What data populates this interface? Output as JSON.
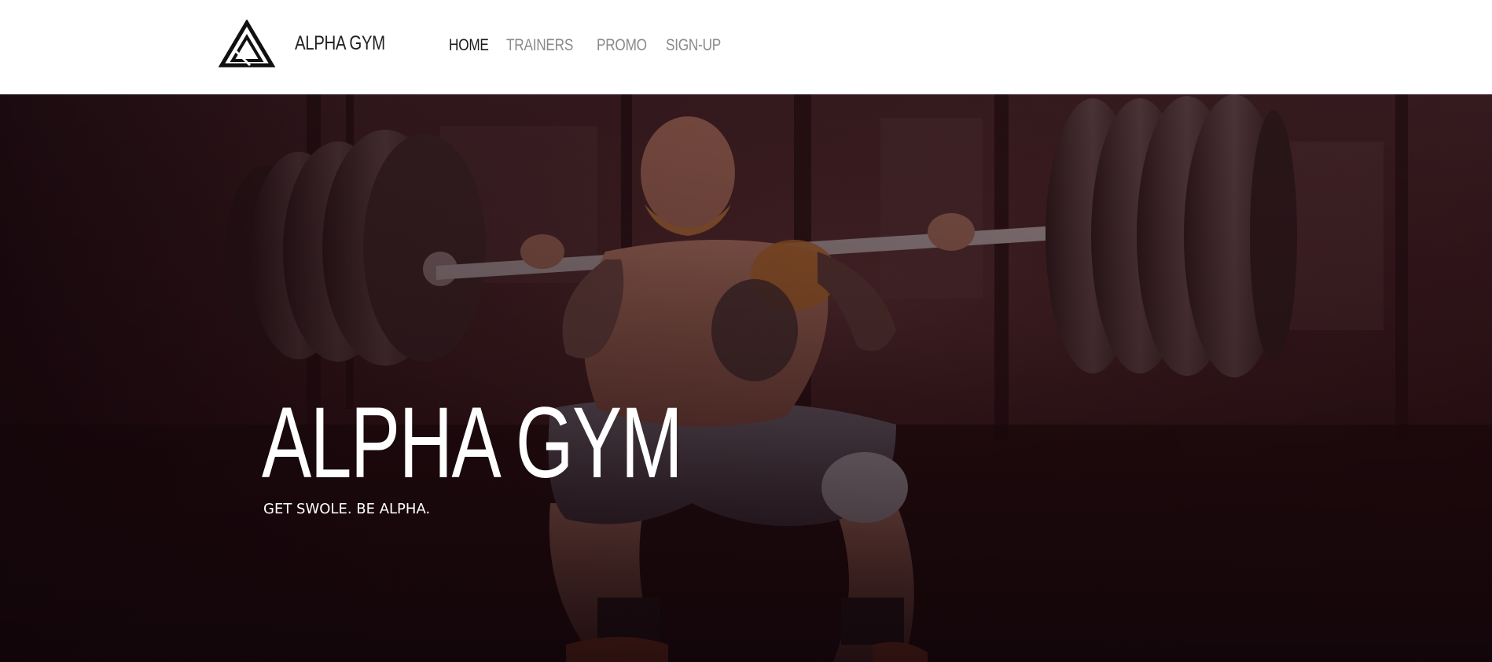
{
  "brand": {
    "name": "ALPHA GYM",
    "logo_icon": "triangle-logo-icon"
  },
  "nav": {
    "items": [
      {
        "label": "HOME",
        "active": true
      },
      {
        "label": "TRAINERS",
        "active": false
      },
      {
        "label": "PROMO",
        "active": false
      },
      {
        "label": "SIGN-UP",
        "active": false
      }
    ]
  },
  "hero": {
    "title": "ALPHA GYM",
    "tagline": "GET SWOLE. BE ALPHA.",
    "image": "weightlifter-squat-photo"
  },
  "colors": {
    "nav_active": "#1a1a1a",
    "nav_inactive": "#8a8a8a",
    "hero_overlay": "#2a0c12"
  }
}
